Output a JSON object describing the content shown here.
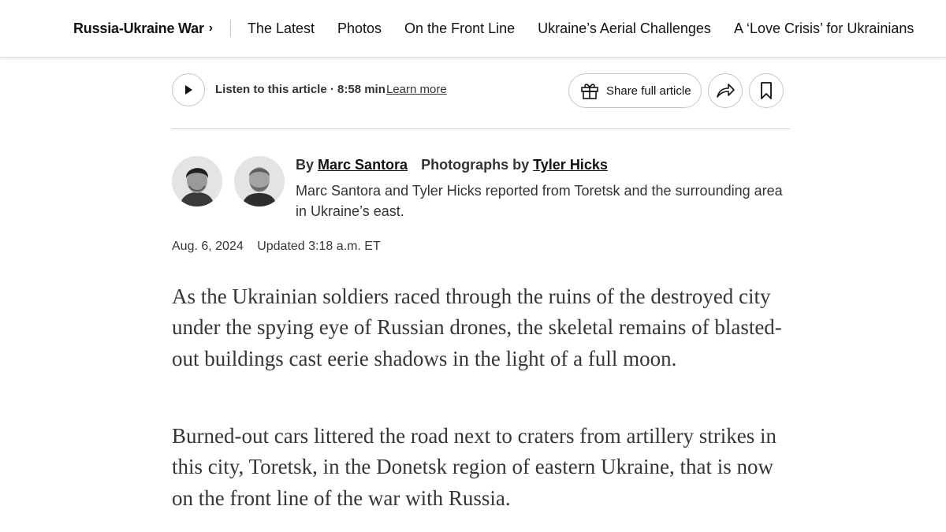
{
  "nav": {
    "section": "Russia-Ukraine War",
    "links": [
      "The Latest",
      "Photos",
      "On the Front Line",
      "Ukraine’s Aerial Challenges",
      "A ‘Love Crisis’ for Ukrainians"
    ]
  },
  "toolbar": {
    "listen": "Listen to this article · 8:58 min",
    "learn_more": "Learn more",
    "share_full": "Share full article"
  },
  "byline": {
    "by": "By",
    "author": "Marc Santora",
    "photos_prefix": "Photographs by",
    "photographer": "Tyler Hicks",
    "note": "Marc Santora and Tyler Hicks reported from Toretsk and the surrounding area in Ukraine’s east."
  },
  "dateline": {
    "date": "Aug. 6, 2024",
    "updated": "Updated 3:18 a.m. ET"
  },
  "article": {
    "paragraphs": [
      "As the Ukrainian soldiers raced through the ruins of the destroyed city under the spying eye of Russian drones, the skeletal remains of blasted-out buildings cast eerie shadows in the light of a full moon.",
      "Burned-out cars littered the road next to craters from artillery strikes in this city, Toretsk, in the Donetsk region of eastern Ukraine, that is now on the front line of the war with Russia."
    ]
  },
  "icons": {
    "play": "play-icon",
    "gift": "gift-icon",
    "share": "share-arrow-icon",
    "bookmark": "bookmark-icon"
  }
}
